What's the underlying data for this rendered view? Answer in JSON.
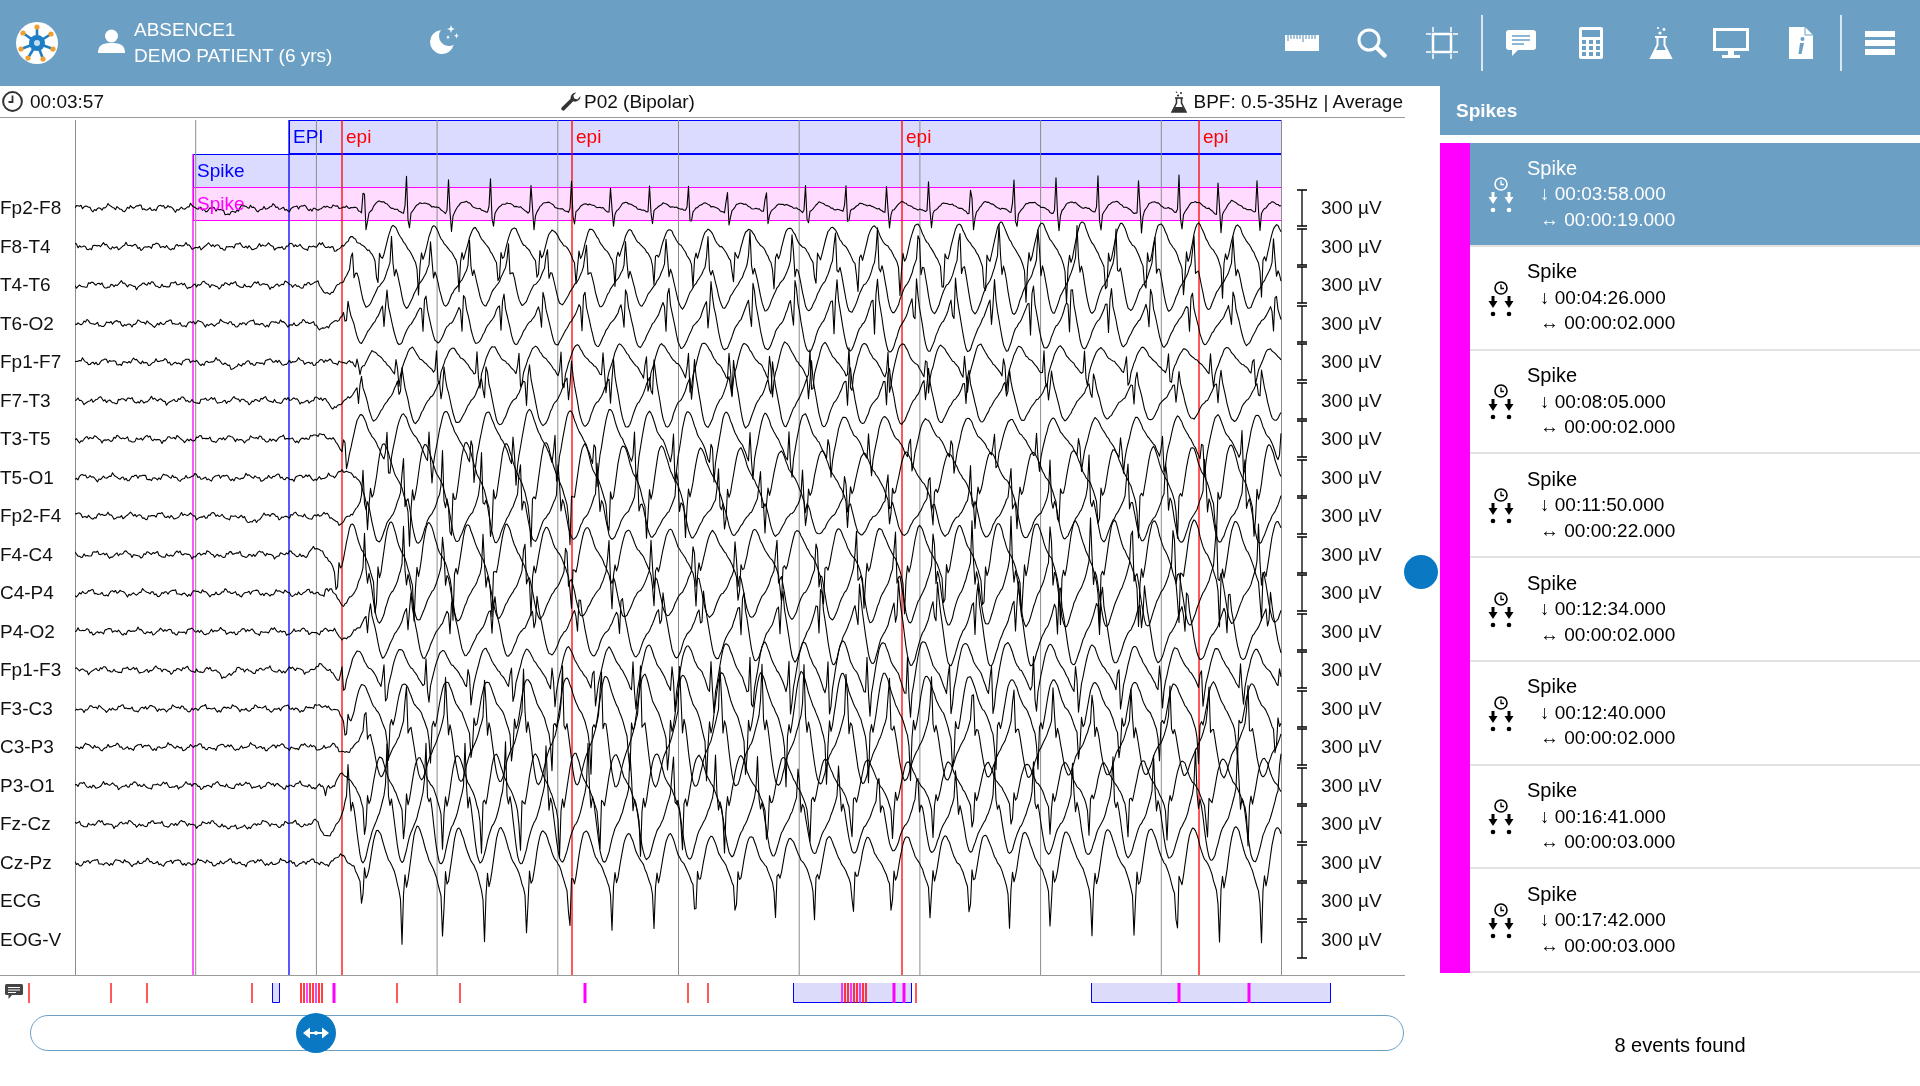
{
  "header": {
    "recording": "ABSENCE1",
    "patient": "DEMO PATIENT (6 yrs)"
  },
  "info_bar": {
    "time": "00:03:57",
    "montage": "P02 (Bipolar)",
    "filter": "BPF: 0.5-35Hz | Average"
  },
  "eeg": {
    "epi_markers": [
      {
        "label": "EPI",
        "color": "#0000ff"
      },
      {
        "label": "epi",
        "color": "#ff0000"
      },
      {
        "label": "epi",
        "color": "#ff0000"
      },
      {
        "label": "epi",
        "color": "#ff0000"
      },
      {
        "label": "epi",
        "color": "#ff0000"
      }
    ],
    "spike_rows": [
      {
        "label": "Spike",
        "color": "#0000ff"
      },
      {
        "label": "Spike",
        "color": "#ff00ff"
      }
    ],
    "channels": [
      {
        "label": "Fp2-F8",
        "scale": "300 µV"
      },
      {
        "label": "F8-T4",
        "scale": "300 µV"
      },
      {
        "label": "T4-T6",
        "scale": "300 µV"
      },
      {
        "label": "T6-O2",
        "scale": "300 µV"
      },
      {
        "label": "Fp1-F7",
        "scale": "300 µV"
      },
      {
        "label": "F7-T3",
        "scale": "300 µV"
      },
      {
        "label": "T3-T5",
        "scale": "300 µV"
      },
      {
        "label": "T5-O1",
        "scale": "300 µV"
      },
      {
        "label": "Fp2-F4",
        "scale": "300 µV"
      },
      {
        "label": "F4-C4",
        "scale": "300 µV"
      },
      {
        "label": "C4-P4",
        "scale": "300 µV"
      },
      {
        "label": "P4-O2",
        "scale": "300 µV"
      },
      {
        "label": "Fp1-F3",
        "scale": "300 µV"
      },
      {
        "label": "F3-C3",
        "scale": "300 µV"
      },
      {
        "label": "C3-P3",
        "scale": "300 µV"
      },
      {
        "label": "P3-O1",
        "scale": "300 µV"
      },
      {
        "label": "Fz-Cz",
        "scale": "300 µV"
      },
      {
        "label": "Cz-Pz",
        "scale": "300 µV"
      },
      {
        "label": "ECG",
        "scale": "300 µV"
      },
      {
        "label": "EOG-V",
        "scale": "300 µV"
      }
    ]
  },
  "events_panel": {
    "title": "Spikes",
    "events": [
      {
        "title": "Spike",
        "onset": "↓ 00:03:58.000",
        "duration": "↔ 00:00:19.000",
        "selected": true
      },
      {
        "title": "Spike",
        "onset": "↓ 00:04:26.000",
        "duration": "↔ 00:00:02.000",
        "selected": false
      },
      {
        "title": "Spike",
        "onset": "↓ 00:08:05.000",
        "duration": "↔ 00:00:02.000",
        "selected": false
      },
      {
        "title": "Spike",
        "onset": "↓ 00:11:50.000",
        "duration": "↔ 00:00:22.000",
        "selected": false
      },
      {
        "title": "Spike",
        "onset": "↓ 00:12:34.000",
        "duration": "↔ 00:00:02.000",
        "selected": false
      },
      {
        "title": "Spike",
        "onset": "↓ 00:12:40.000",
        "duration": "↔ 00:00:02.000",
        "selected": false
      },
      {
        "title": "Spike",
        "onset": "↓ 00:16:41.000",
        "duration": "↔ 00:00:03.000",
        "selected": false
      },
      {
        "title": "Spike",
        "onset": "↓ 00:17:42.000",
        "duration": "↔ 00:00:03.000",
        "selected": false
      }
    ],
    "summary": "8 events found"
  }
}
